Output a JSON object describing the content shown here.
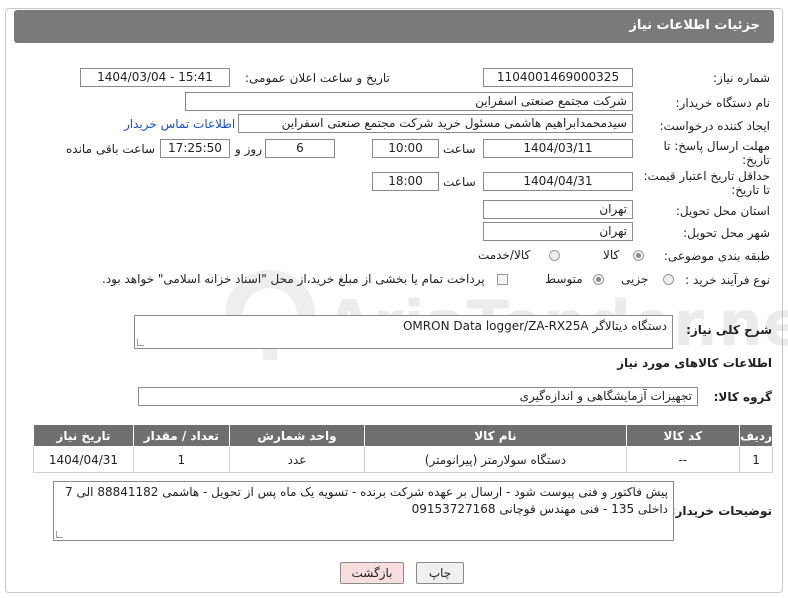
{
  "header": {
    "title": "جزئیات اطلاعات نیاز"
  },
  "fields": {
    "need_number_label": "شماره نیاز:",
    "need_number": "1104001469000325",
    "announce_label": "تاریخ و ساعت اعلان عمومی:",
    "announce_value": "1404/03/04 - 15:41",
    "buyer_org_label": "نام دستگاه خریدار:",
    "buyer_org": "شرکت مجتمع صنعتی اسفراین",
    "requester_label": "ایجاد کننده درخواست:",
    "requester": "سیدمحمدابراهیم هاشمی مسئول خرید شرکت مجتمع صنعتی اسفراین",
    "contact_link": "اطلاعات تماس خریدار",
    "send_deadline_label_1": "مهلت ارسال پاسخ: تا",
    "send_deadline_label_2": "تاریخ:",
    "send_date": "1404/03/11",
    "time_label": "ساعت",
    "send_time": "10:00",
    "days_value": "6",
    "days_label": "روز و",
    "remaining_time": "17:25:50",
    "remaining_label": "ساعت باقی مانده",
    "price_deadline_label_1": "حداقل تاریخ اعتبار قیمت:",
    "price_deadline_label_2": "تا تاریخ:",
    "price_date": "1404/04/31",
    "price_time": "18:00",
    "province_label": "استان محل تحویل:",
    "province": "تهران",
    "city_label": "شهر محل تحویل:",
    "city": "تهران",
    "category_label": "طبقه بندی موضوعی:",
    "category_options": [
      "کالا",
      "کالا/خدمت"
    ],
    "process_label": "نوع فرآیند خرید :",
    "process_options": [
      "جزیی",
      "متوسط"
    ],
    "process_note": "پرداخت تمام یا بخشی از مبلغ خرید،از محل \"اسناد خزانه اسلامی\" خواهد بود."
  },
  "description": {
    "label": "شرح کلی نیاز:",
    "value": "دستگاه دیتالاگر OMRON Data logger/ZA-RX25A"
  },
  "goods_section": {
    "title": "اطلاعات کالاهای مورد نیاز",
    "group_label": "گروه کالا:",
    "group_value": "تجهیزات آزمایشگاهی و اندازه‌گیری"
  },
  "table": {
    "headers": [
      "ردیف",
      "کد کالا",
      "نام کالا",
      "واحد شمارش",
      "تعداد / مقدار",
      "تاریخ نیاز"
    ],
    "rows": [
      [
        "1",
        "--",
        "دستگاه سولارمتر (پیرانومتر)",
        "عدد",
        "1",
        "1404/04/31"
      ]
    ]
  },
  "buyer_notes": {
    "label": "توضیحات خریدار:",
    "line1": "پیش فاکتور و فنی پیوست شود - ارسال بر عهده شرکت برنده - تسویه یک ماه پس از تحویل - هاشمی 88841182 الی 7",
    "line2": "داخلی 135 - فنی مهندس  قوچانی 09153727168"
  },
  "buttons": {
    "print": "چاپ",
    "back": "بازگشت"
  },
  "watermark": {
    "text": "AriaTender.neT"
  },
  "colors": {
    "header_bg": "#7a7a7a",
    "link": "#1a4fd0",
    "back_button_bg": "#f7dede",
    "table_header_bg": "#6f6f6f"
  }
}
